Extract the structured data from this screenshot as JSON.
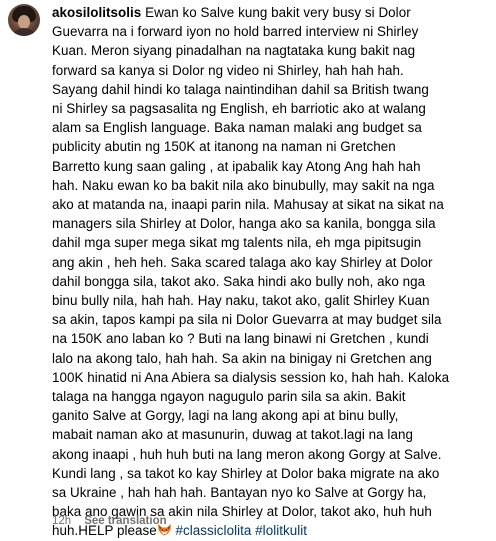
{
  "comment": {
    "username": "akosilolitsolis",
    "lines": [
      " Ewan ko Salve kung bakit very busy si Dolor",
      "Guevarra na i forward iyon no hold barred interview ni Shirley",
      "Kuan. Meron siyang pinadalhan na nagtataka kung bakit nag",
      "forward sa kanya si Dolor ng video ni Shirley, hah hah hah.",
      "Sayang dahil hindi ko talaga naintindihan dahil sa British twang",
      "ni Shirley sa pagsasalita ng English, eh barriotic ako at walang",
      "alam sa English language. Baka naman malaki ang budget sa",
      "publicity abutin ng 150K at itanong na naman ni Gretchen",
      "Barretto kung saan galing , at ipabalik kay Atong Ang hah hah",
      "hah. Naku ewan ko ba bakit nila ako binubully, may sakit na nga",
      "ako at matanda na, inaapi parin nila. Mahusay at sikat na sikat na",
      "managers sila Shirley at Dolor, hanga ako sa kanila, bongga sila",
      "dahil mga super mega sikat mg talents nila, eh mga pipitsugin",
      "ang akin , heh heh. Saka scared talaga ako kay Shirley at Dolor",
      "dahil bongga sila, takot ako. Saka hindi ako bully noh, ako nga",
      "binu bully nila, hah hah. Hay naku, takot ako, galit Shirley Kuan",
      "sa akin, tapos kampi pa sila ni Dolor Guevarra at may budget sila",
      "na 150K ano laban ko ? Buti na lang binawi ni Gretchen , kundi",
      "lalo na akong talo, hah hah. Sa akin na binigay ni Gretchen ang",
      "100K hinatid ni Ana Abiera sa dialysis session ko, hah hah. Kaloka",
      "talaga na hangga ngayon nagugulo parin sila sa akin. Bakit",
      "ganito Salve at Gorgy, lagi na lang akong api at binu bully,",
      "mabait naman ako at masunurin, duwag at takot.lagi na lang",
      "akong inaapi , huh huh buti na lang meron akong Gorgy at Salve.",
      "Kundi lang , sa takot ko kay Shirley at Dolor baka migrate na ako",
      "sa Ukraine , hah hah hah. Bantayan nyo ko Salve at Gorgy ha,",
      "baka ano gawin sa akin nila Shirley at Dolor, takot ako, huh huh"
    ],
    "last_line_prefix": "huh.HELP please",
    "emoji_icon": "fox-face-icon",
    "hashtags": [
      "#classiclolita",
      "#lolitkulit"
    ],
    "hashtag_color": "#00376b",
    "time_ago": "12h",
    "see_translation": "See translation",
    "meta_color": "#737373"
  }
}
